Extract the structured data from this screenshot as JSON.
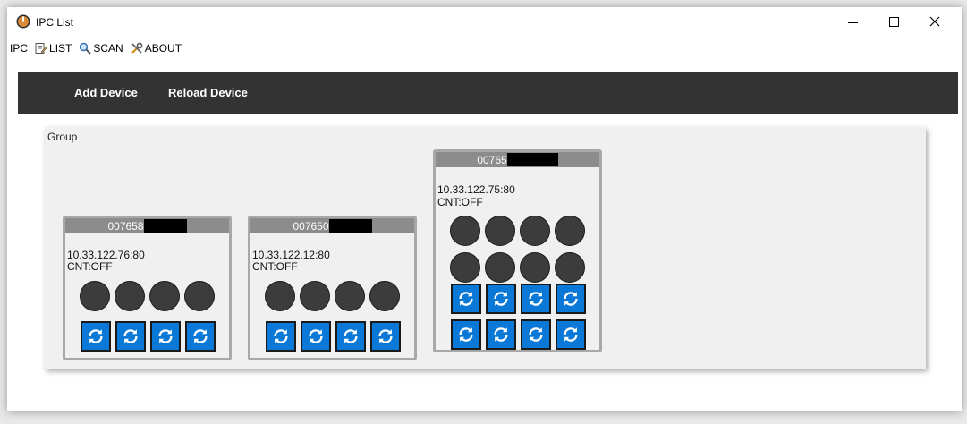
{
  "window": {
    "title": "IPC List",
    "controls": {
      "minimize": "minimize-icon",
      "maximize": "maximize-icon",
      "close": "close-icon"
    }
  },
  "menu": [
    {
      "label": "IPC",
      "icon": ""
    },
    {
      "label": "LIST",
      "icon": "list-edit-icon"
    },
    {
      "label": "SCAN",
      "icon": "magnifier-icon"
    },
    {
      "label": "ABOUT",
      "icon": "tools-icon"
    }
  ],
  "toolbar": {
    "add_label": "Add Device",
    "reload_label": "Reload Device"
  },
  "group": {
    "label": "Group",
    "devices": [
      {
        "id": "007658",
        "ip": "10.33.122.76:80",
        "cnt": "CNT:OFF",
        "indicators": 4,
        "refresh_buttons": 4
      },
      {
        "id": "007650",
        "ip": "10.33.122.12:80",
        "cnt": "CNT:OFF",
        "indicators": 4,
        "refresh_buttons": 4
      },
      {
        "id": "00765",
        "ip": "10.33.122.75:80",
        "cnt": "CNT:OFF",
        "indicators": 8,
        "refresh_buttons": 8
      }
    ]
  },
  "colors": {
    "toolbar_bg": "#333333",
    "button_blue": "#0a78d7",
    "indicator": "#3c3c3c",
    "card_header": "#8c8c8c"
  }
}
